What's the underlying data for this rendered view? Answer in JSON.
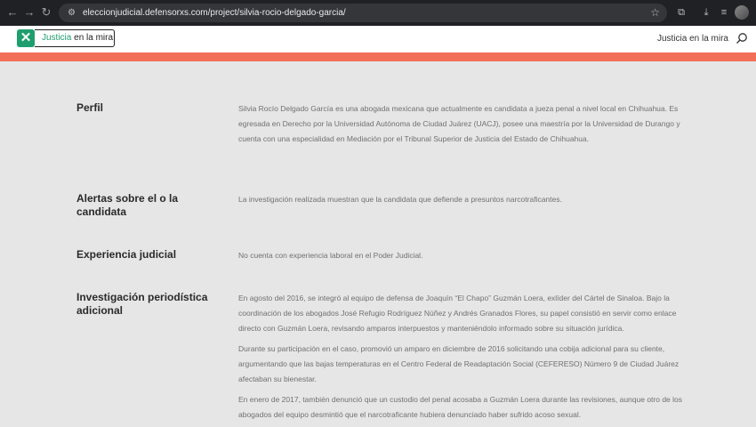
{
  "browser": {
    "url": "eleccionjudicial.defensorxs.com/project/silvia-rocio-delgado-garcia/"
  },
  "header": {
    "logo_mark": "✕",
    "logo_word1": "Justicia",
    "logo_word2": " en la mira",
    "nav_link": "Justicia en la mira"
  },
  "colors": {
    "accent": "#f27057",
    "brand_green": "#1f9e6e",
    "background": "#e6e6e6"
  },
  "sections": [
    {
      "label": "Perfil",
      "paragraphs": [
        "Silvia Rocío Delgado García es una abogada mexicana que actualmente es candidata a jueza penal a nivel local en Chihuahua. Es egresada en Derecho por la Universidad Autónoma de Ciudad Juárez (UACJ), posee una maestría por la Universidad de Durango y cuenta con una especialidad en Mediación por el Tribunal Superior de Justicia del Estado de Chihuahua."
      ]
    },
    {
      "label": "Alertas sobre el o la candidata",
      "paragraphs": [
        "La investigación realizada muestran que la candidata que defiende a presuntos narcotraficantes."
      ]
    },
    {
      "label": "Experiencia judicial",
      "paragraphs": [
        "No cuenta con experiencia laboral en el Poder Judicial."
      ]
    },
    {
      "label": "Investigación periodística adicional",
      "paragraphs": [
        "En agosto del 2016, se integró al equipo de defensa de Joaquín “El Chapo” Guzmán Loera, exlíder del Cártel de Sinaloa. Bajo la coordinación de los abogados José Refugio Rodríguez Núñez y Andrés Granados Flores, su papel consistió en servir como enlace directo con Guzmán Loera, revisando amparos interpuestos y manteniéndolo informado sobre su situación jurídica.",
        "Durante su participación en el caso, promovió un amparo en diciembre de 2016 solicitando una cobija adicional para su cliente, argumentando que las bajas temperaturas en el Centro Federal de Readaptación Social (CEFERESO) Número 9 de Ciudad Juárez afectaban su bienestar.",
        "En enero de 2017, también denunció que un custodio del penal acosaba a Guzmán Loera durante las revisiones, aunque otro de los abogados del equipo desmintió que el narcotraficante hubiera denunciado haber sufrido acoso sexual."
      ]
    }
  ]
}
